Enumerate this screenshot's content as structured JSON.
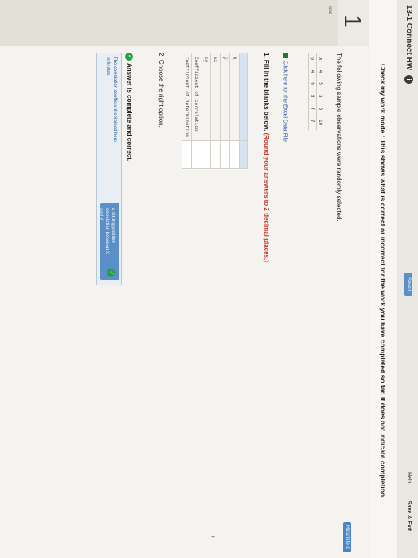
{
  "header": {
    "title": "13-1 Connect HW",
    "info_symbol": "i",
    "saved_label": "Saved",
    "help_label": "Help",
    "save_exit_label": "Save & Exit"
  },
  "banner": {
    "text": "Check my work mode : This shows what is correct or incorrect for the work you have completed so far. It does not indicate completion.",
    "return_label": "Return to q"
  },
  "question": {
    "number": "1",
    "side_label": "ons",
    "intro": "The following sample observations were randomly selected.",
    "observations": {
      "x_label": "x",
      "y_label": "y",
      "x_values": [
        "4",
        "5",
        "3",
        "6",
        "10"
      ],
      "y_values": [
        "4",
        "6",
        "5",
        "7",
        "7"
      ]
    },
    "excel_link": "Click here for the Excel Data File",
    "part1_prefix": "1. Fill in the blanks below. ",
    "part1_instruction": "(Round your answers to 2 decimal places.)",
    "stats": [
      {
        "label": "x̄"
      },
      {
        "label": "ȳ"
      },
      {
        "label": "sx"
      },
      {
        "label": "sy"
      },
      {
        "label": "Coefficient of correlation"
      },
      {
        "label": "Coefficient of determination"
      }
    ],
    "part2": "2. Choose the right option.",
    "complete_text": "Answer is complete and correct.",
    "choice": {
      "line1": "The correlation coefficient obtained here",
      "line2": "indicates",
      "selected_line1": "a strong positive",
      "selected_line2": "correlation between X",
      "selected_line3": "and Y."
    }
  }
}
